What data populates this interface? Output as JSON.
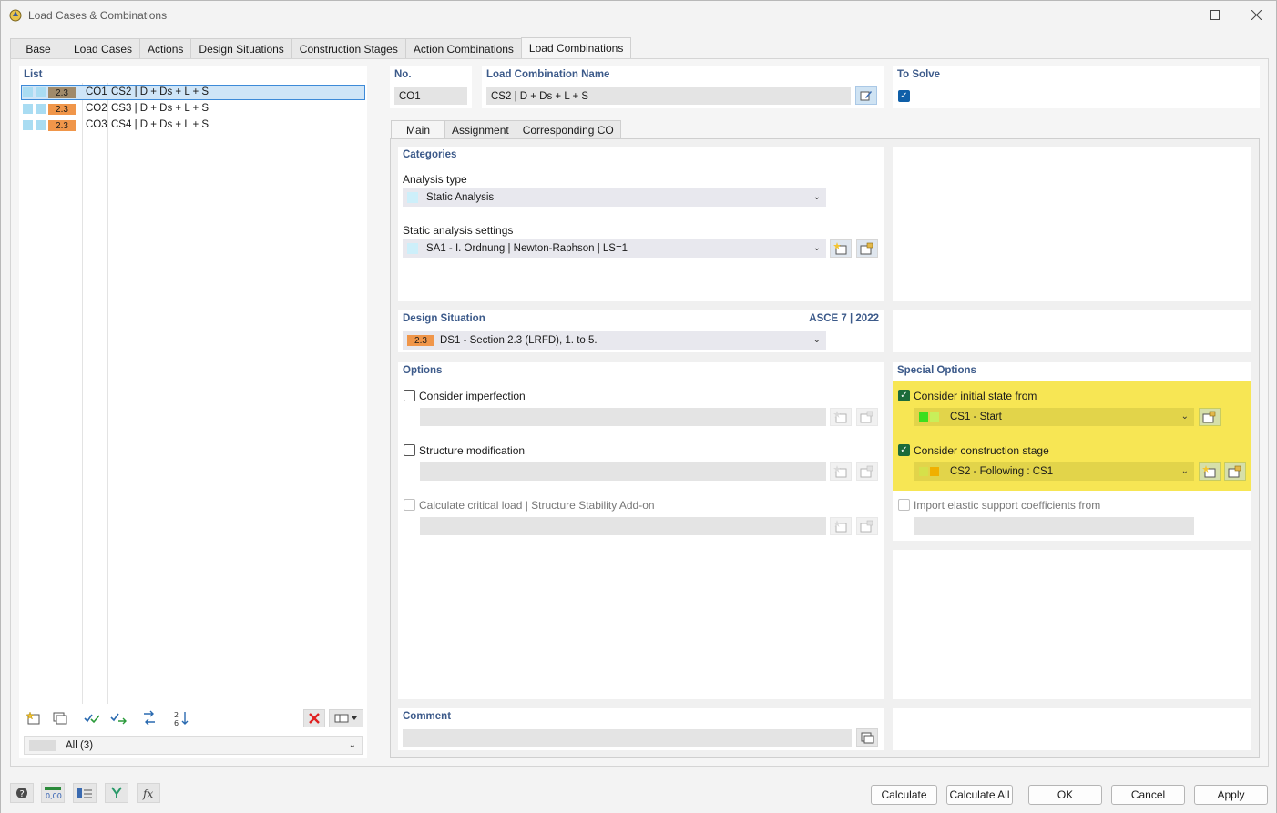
{
  "window": {
    "title": "Load Cases & Combinations",
    "controls": [
      "minimize-icon",
      "maximize-icon",
      "close-icon"
    ]
  },
  "tabs": [
    "Base",
    "Load Cases",
    "Actions",
    "Design Situations",
    "Construction Stages",
    "Action Combinations",
    "Load Combinations"
  ],
  "active_tab": "Load Combinations",
  "list": {
    "header": "List",
    "rows": [
      {
        "badge": "2.3",
        "id": "CO1",
        "name": "CS2 | D + Ds + L + S",
        "badge_color": "#a08a6a"
      },
      {
        "badge": "2.3",
        "id": "CO2",
        "name": "CS3 | D + Ds + L + S",
        "badge_color": "#f0964a"
      },
      {
        "badge": "2.3",
        "id": "CO3",
        "name": "CS4 | D + Ds + L + S",
        "badge_color": "#f0964a"
      }
    ],
    "filter": "All (3)"
  },
  "header": {
    "no_label": "No.",
    "no_value": "CO1",
    "name_label": "Load Combination Name",
    "name_value": "CS2 | D + Ds + L + S",
    "to_solve_label": "To Solve"
  },
  "subtabs": [
    "Main",
    "Assignment",
    "Corresponding CO"
  ],
  "categories": {
    "title": "Categories",
    "analysis_type_label": "Analysis type",
    "analysis_type_value": "Static Analysis",
    "static_settings_label": "Static analysis settings",
    "static_settings_value": "SA1 - I. Ordnung | Newton-Raphson | LS=1"
  },
  "design_situation": {
    "title": "Design Situation",
    "standard": "ASCE 7 | 2022",
    "badge": "2.3",
    "value": "DS1 - Section 2.3 (LRFD), 1. to 5."
  },
  "options": {
    "title": "Options",
    "consider_imperfection": "Consider imperfection",
    "structure_modification": "Structure modification",
    "critical_load": "Calculate critical load | Structure Stability Add-on"
  },
  "special": {
    "title": "Special Options",
    "initial_state_label": "Consider initial state from",
    "initial_state_value": "CS1 - Start",
    "construction_stage_label": "Consider construction stage",
    "construction_stage_value": "CS2 - Following : CS1",
    "elastic_label": "Import elastic support coefficients from"
  },
  "comment": {
    "title": "Comment"
  },
  "buttons": {
    "calculate": "Calculate",
    "calculate_all": "Calculate All",
    "ok": "OK",
    "cancel": "Cancel",
    "apply": "Apply"
  },
  "colors": {
    "highlight": "#f7e654",
    "accent_blue": "#3c5a8a",
    "badge_orange": "#f0964a"
  }
}
